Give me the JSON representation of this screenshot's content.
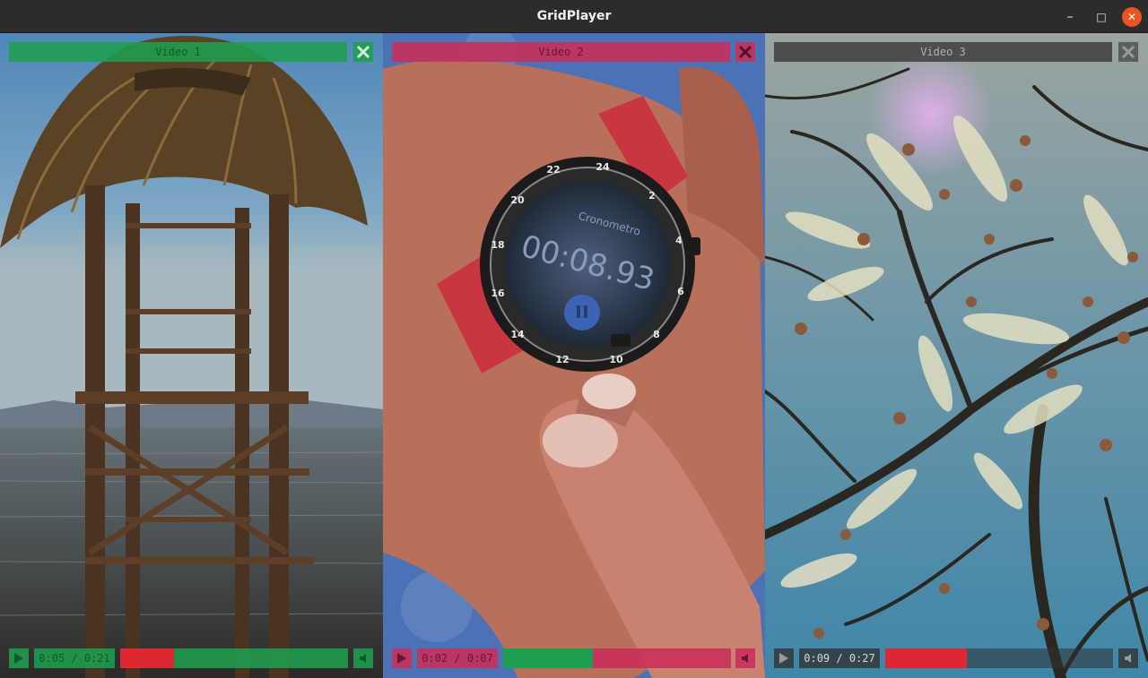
{
  "window": {
    "title": "GridPlayer"
  },
  "colors": {
    "green": "#1e9e50",
    "red": "#dc2832",
    "dark": "#3a3a3a",
    "pink": "#c82e5a"
  },
  "videos": [
    {
      "title": "Video 1",
      "time": "0:05 / 0:21",
      "progress": 0.238
    },
    {
      "title": "Video 2",
      "time": "0:02 / 0:07",
      "progress": 0.286
    },
    {
      "title": "Video 3",
      "time": "0:09 / 0:27",
      "progress": 0.333
    }
  ],
  "watch": {
    "brand": "Cronometro",
    "stopwatch": "00:08.93",
    "bezel": [
      "22",
      "24",
      "2",
      "4",
      "6",
      "8",
      "10",
      "12",
      "14",
      "16",
      "18",
      "20"
    ]
  }
}
